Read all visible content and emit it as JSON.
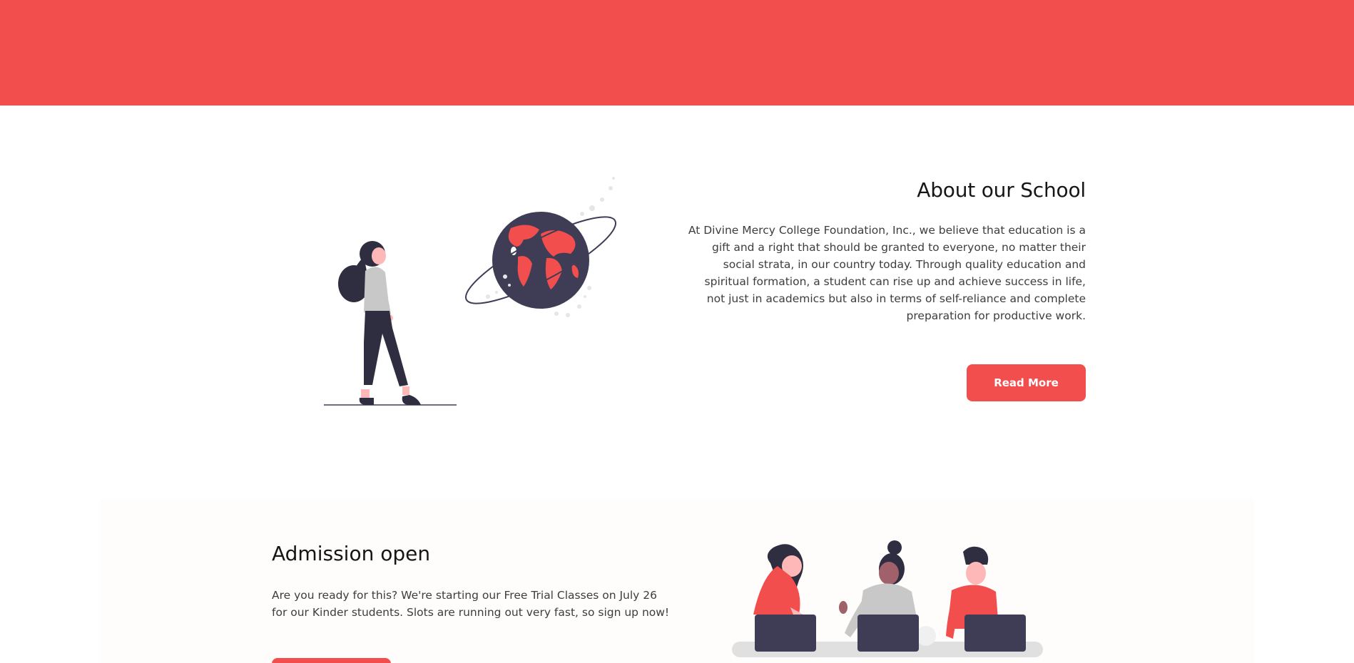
{
  "colors": {
    "accent": "#f24e4e",
    "dark": "#3f3d56",
    "gray": "#c8c8c8",
    "skin": "#ffb8b8"
  },
  "about": {
    "title": "About our School",
    "body": "At Divine Mercy College Foundation, Inc., we believe that education is a gift and a right that should be granted to everyone, no matter their social strata, in our country today. Through quality education and spiritual formation, a student can rise up and achieve success in life, not just in academics but also in terms of self-reliance and complete preparation for productive work.",
    "button_label": "Read More",
    "illustration_icon": "woman-looking-at-globe-illustration"
  },
  "admission": {
    "title": "Admission open",
    "body": "Are you ready for this? We're starting our Free Trial Classes on July 26 for our Kinder students. Slots are running out very fast, so sign up now!",
    "illustration_icon": "students-with-laptops-illustration"
  }
}
